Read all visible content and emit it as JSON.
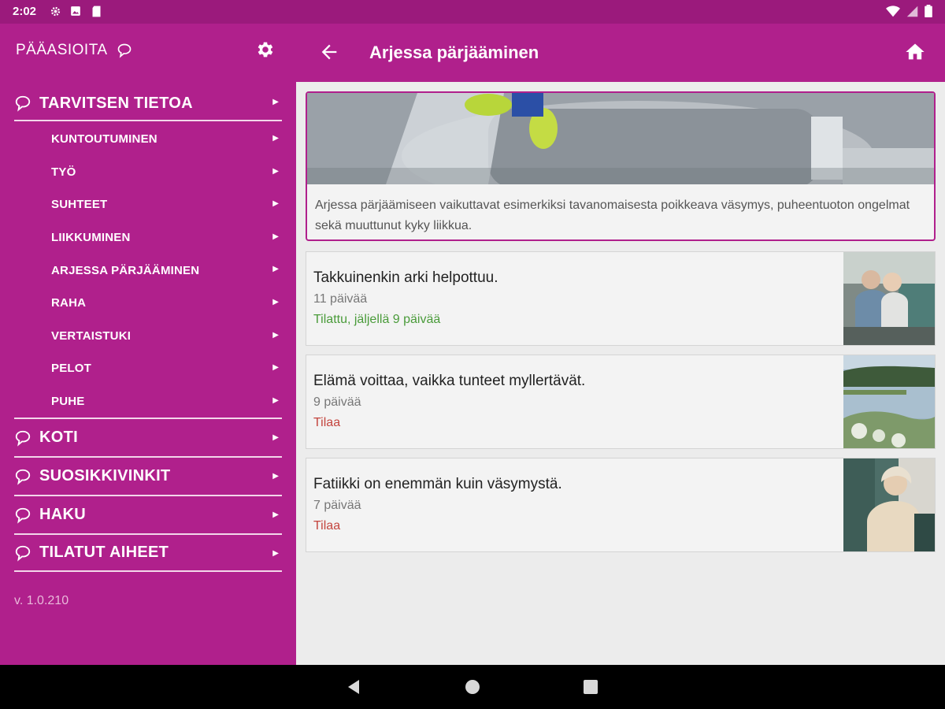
{
  "status": {
    "time": "2:02",
    "icons": [
      "settings-icon",
      "image-icon",
      "sd-card-icon"
    ],
    "right_icons": [
      "wifi-icon",
      "signal-icon",
      "battery-icon"
    ]
  },
  "sidebar": {
    "title": "PÄÄASIOITA",
    "top_item": {
      "label": "TARVITSEN TIETOA"
    },
    "sub_items": [
      {
        "label": "KUNTOUTUMINEN"
      },
      {
        "label": "TYÖ"
      },
      {
        "label": "SUHTEET"
      },
      {
        "label": "LIIKKUMINEN"
      },
      {
        "label": "ARJESSA PÄRJÄÄMINEN"
      },
      {
        "label": "RAHA"
      },
      {
        "label": "VERTAISTUKI"
      },
      {
        "label": "PELOT"
      },
      {
        "label": "PUHE"
      }
    ],
    "groups": [
      {
        "label": "KOTI"
      },
      {
        "label": "SUOSIKKIVINKIT"
      },
      {
        "label": "HAKU"
      },
      {
        "label": "TILATUT AIHEET"
      }
    ],
    "version": "v. 1.0.210"
  },
  "appbar": {
    "title": "Arjessa pärjääminen"
  },
  "hero": {
    "text": "Arjessa pärjäämiseen vaikuttavat esimerkiksi tavanomaisesta poikkeava väsymys, puheentuoton ongelmat sekä muuttunut kyky liikkua."
  },
  "cards": [
    {
      "title": "Takkuinenkin arki helpottuu.",
      "duration": "11 päivää",
      "status": "Tilattu, jäljellä 9 päivää"
    },
    {
      "title": "Elämä voittaa, vaikka tunteet myllertävät.",
      "duration": "9 päivää",
      "status": "Tilaa"
    },
    {
      "title": "Fatiikki on enemmän kuin väsymystä.",
      "duration": "7 päivää",
      "status": "Tilaa"
    }
  ],
  "colors": {
    "primary": "#b0208c",
    "statusbar": "#9b1a7c",
    "subscribed": "#4a9b3a",
    "subscribe": "#c4453e"
  }
}
